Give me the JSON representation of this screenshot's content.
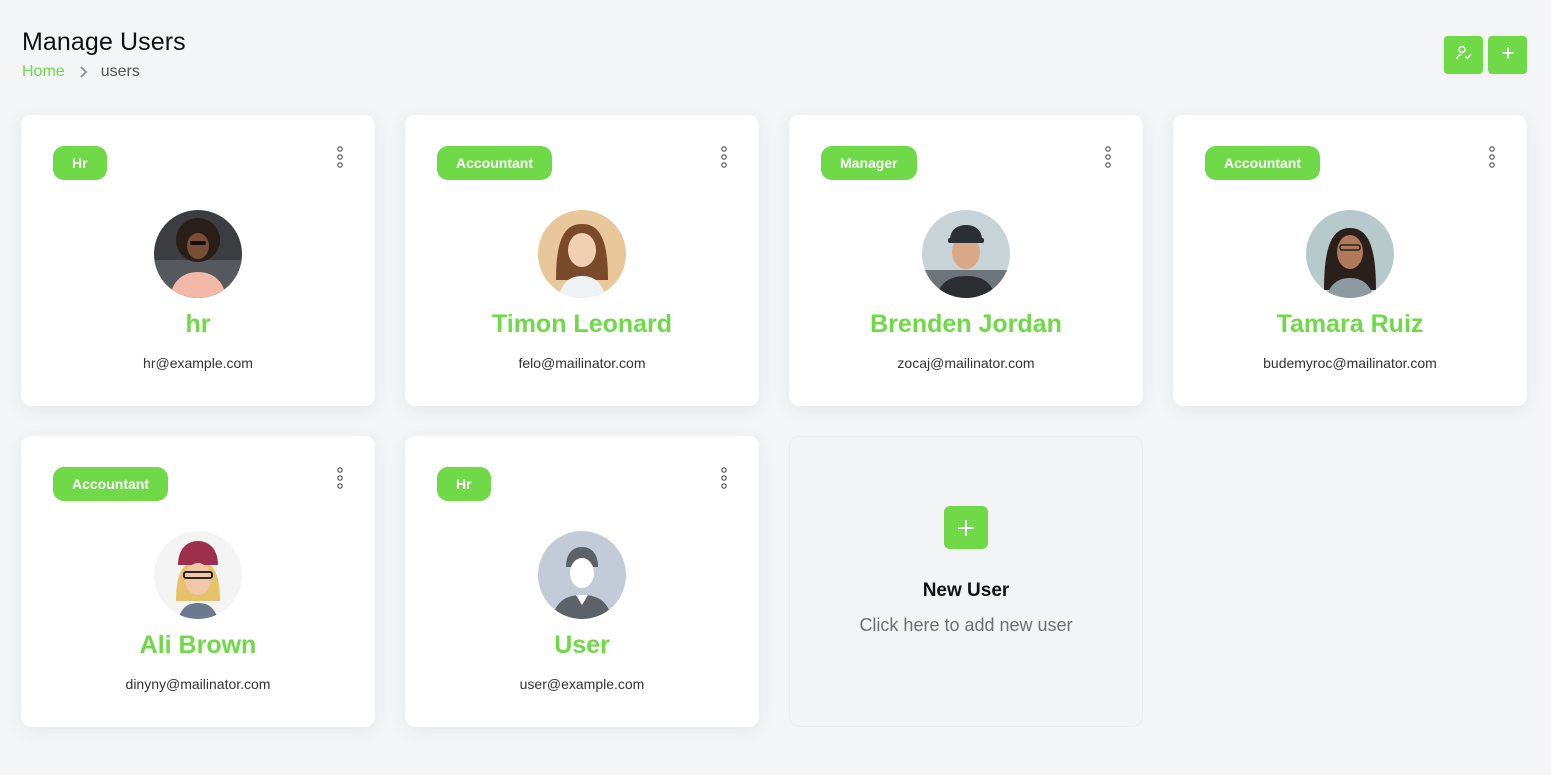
{
  "header": {
    "title": "Manage Users",
    "breadcrumb": {
      "home": "Home",
      "current": "users"
    }
  },
  "actions": [
    {
      "icon": "user-check-icon"
    },
    {
      "icon": "plus-icon"
    }
  ],
  "colors": {
    "accent": "#6fd947",
    "page_bg": "#f4f5f7"
  },
  "users": [
    {
      "role": "Hr",
      "name": "hr",
      "email": "hr@example.com",
      "avatar": "avatar-photo"
    },
    {
      "role": "Accountant",
      "name": "Timon Leonard",
      "email": "felo@mailinator.com",
      "avatar": "avatar-photo"
    },
    {
      "role": "Manager",
      "name": "Brenden Jordan",
      "email": "zocaj@mailinator.com",
      "avatar": "avatar-photo"
    },
    {
      "role": "Accountant",
      "name": "Tamara Ruiz",
      "email": "budemyroc@mailinator.com",
      "avatar": "avatar-photo"
    },
    {
      "role": "Accountant",
      "name": "Ali Brown",
      "email": "dinyny@mailinator.com",
      "avatar": "avatar-photo"
    },
    {
      "role": "Hr",
      "name": "User",
      "email": "user@example.com",
      "avatar": "default-avatar"
    }
  ],
  "new_user": {
    "title": "New User",
    "subtitle": "Click here to add new user"
  }
}
